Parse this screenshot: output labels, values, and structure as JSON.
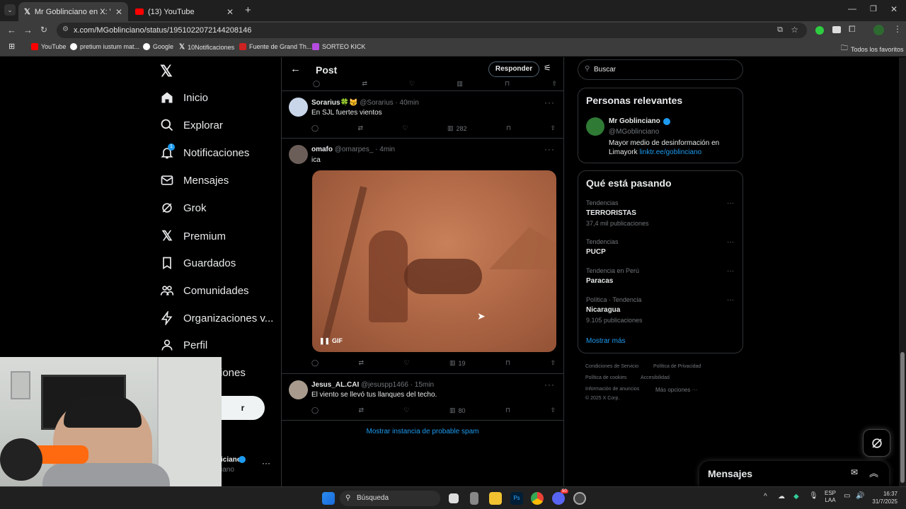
{
  "browser": {
    "tabs": [
      {
        "title": "Mr Goblinciano en X: \"Se repor",
        "active": true
      },
      {
        "title": "(13) YouTube",
        "active": false
      }
    ],
    "url": "x.com/MGoblinciano/status/1951022072144208146",
    "bookmarks": [
      "YouTube",
      "pretium iustum mat...",
      "Google",
      "10Notificaciones",
      "Fuente de Grand Th...",
      "SORTEO KICK"
    ],
    "all_bookmarks": "Todos los favoritos"
  },
  "nav": {
    "items": [
      "Inicio",
      "Explorar",
      "Notificaciones",
      "Mensajes",
      "Grok",
      "Premium",
      "Guardados",
      "Comunidades",
      "Organizaciones v...",
      "Perfil"
    ],
    "partial_more": "iones",
    "notif_badge": "1",
    "post_button_partial": "r",
    "account_partial_name": "iciano",
    "account_partial_handle": "iano"
  },
  "header": {
    "title": "Post",
    "reply_button": "Responder"
  },
  "tweets": [
    {
      "name": "Sorarius🍀😼",
      "handle": "@Sorarius · 40min",
      "text": "En SJL fuertes vientos",
      "views": "282"
    },
    {
      "name": "omafo",
      "handle": "@omarpes_ · 4min",
      "text": "ica",
      "views": "19",
      "media_label": "GIF"
    },
    {
      "name": "Jesus_AL.CAI",
      "handle": "@jesuspp1466 · 15min",
      "text": "El viento se llevó tus llanques del techo.",
      "views": "80"
    }
  ],
  "spam_link": "Mostrar instancia de probable spam",
  "search": {
    "placeholder": "Buscar"
  },
  "relevant": {
    "title": "Personas relevantes",
    "name": "Mr Goblinciano",
    "handle": "@MGoblinciano",
    "bio": "Mayor medio de desinformación en Limayork",
    "link": "linktr.ee/goblinciano"
  },
  "trends": {
    "title": "Qué está pasando",
    "items": [
      {
        "context": "Tendencias",
        "name": "TERRORISTAS",
        "count": "37,4 mil publicaciones"
      },
      {
        "context": "Tendencias",
        "name": "PUCP",
        "count": ""
      },
      {
        "context": "Tendencia en Perú",
        "name": "Paracas",
        "count": ""
      },
      {
        "context": "Política · Tendencia",
        "name": "Nicaragua",
        "count": "9.105 publicaciones"
      }
    ],
    "show_more": "Mostrar más"
  },
  "footer": {
    "links": [
      "Condiciones de Servicio",
      "Política de Privacidad",
      "Política de cookies",
      "Accesibilidad",
      "Información de anuncios",
      "Más opciones ···"
    ],
    "copyright": "© 2025 X Corp."
  },
  "messages_drawer": {
    "title": "Mensajes"
  },
  "taskbar": {
    "search": "Búsqueda",
    "lang": "ESP",
    "layout": "LAA",
    "time": "16:37",
    "date": "31/7/2025",
    "discord_badge": "50"
  },
  "colors": {
    "accent": "#1d9bf0",
    "bg": "#000000",
    "border": "#2f3336",
    "muted": "#71767b"
  }
}
